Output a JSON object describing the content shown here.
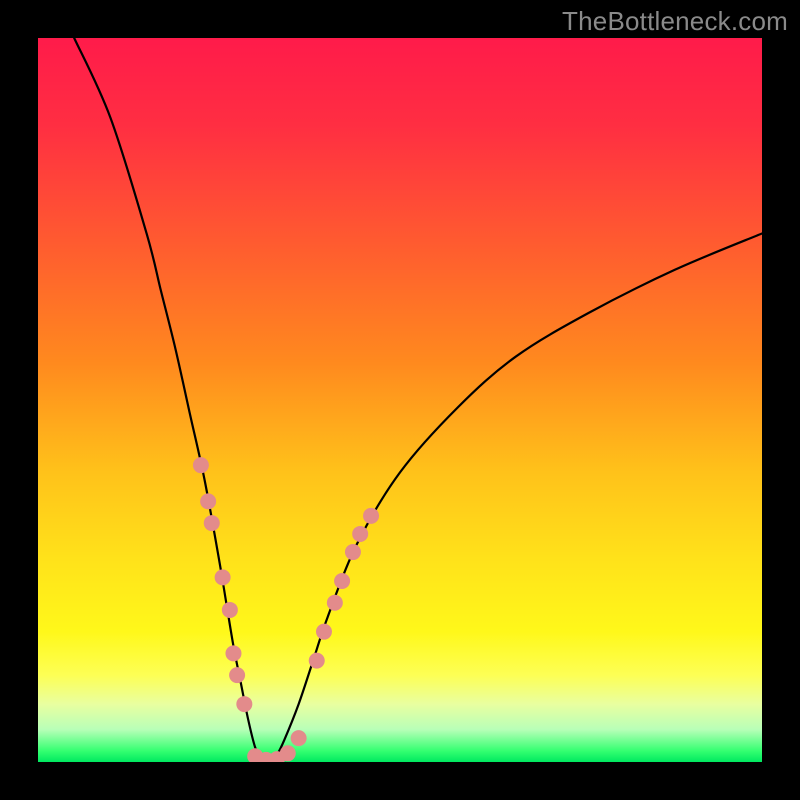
{
  "watermark": "TheBottleneck.com",
  "gradient_stops": [
    {
      "offset": 0.0,
      "color": "#ff1b4a"
    },
    {
      "offset": 0.12,
      "color": "#ff2e42"
    },
    {
      "offset": 0.28,
      "color": "#ff5a30"
    },
    {
      "offset": 0.45,
      "color": "#ff8a1e"
    },
    {
      "offset": 0.6,
      "color": "#ffc21a"
    },
    {
      "offset": 0.72,
      "color": "#ffe21a"
    },
    {
      "offset": 0.82,
      "color": "#fff81a"
    },
    {
      "offset": 0.88,
      "color": "#fdff55"
    },
    {
      "offset": 0.92,
      "color": "#e9ffa0"
    },
    {
      "offset": 0.955,
      "color": "#b8ffb8"
    },
    {
      "offset": 0.985,
      "color": "#33ff70"
    },
    {
      "offset": 1.0,
      "color": "#00e860"
    }
  ],
  "chart_data": {
    "type": "line",
    "title": "",
    "xlabel": "",
    "ylabel": "",
    "xlim": [
      0,
      100
    ],
    "ylim": [
      0,
      100
    ],
    "grid": false,
    "series": [
      {
        "name": "bottleneck-curve",
        "x": [
          5,
          10,
          15,
          17,
          19,
          21,
          23,
          25,
          26,
          27,
          28,
          29,
          30,
          31,
          32,
          33,
          34,
          36,
          38,
          40,
          44,
          50,
          58,
          66,
          76,
          88,
          100
        ],
        "y": [
          100,
          89,
          73,
          65,
          57,
          48,
          39,
          28,
          22,
          16,
          11,
          6,
          2,
          0,
          0,
          1,
          3,
          8,
          14,
          20,
          30,
          40,
          49,
          56,
          62,
          68,
          73
        ]
      }
    ],
    "markers": [
      {
        "name": "dots-left",
        "color": "#e38b8b",
        "radius": 8,
        "points": [
          {
            "x": 22.5,
            "y": 41
          },
          {
            "x": 23.5,
            "y": 36
          },
          {
            "x": 24.0,
            "y": 33
          },
          {
            "x": 25.5,
            "y": 25.5
          },
          {
            "x": 26.5,
            "y": 21
          },
          {
            "x": 27.0,
            "y": 15
          },
          {
            "x": 27.5,
            "y": 12
          },
          {
            "x": 28.5,
            "y": 8
          }
        ]
      },
      {
        "name": "dots-bottom",
        "color": "#e38b8b",
        "radius": 8,
        "points": [
          {
            "x": 30.0,
            "y": 0.8
          },
          {
            "x": 31.5,
            "y": 0.3
          },
          {
            "x": 33.0,
            "y": 0.4
          },
          {
            "x": 34.5,
            "y": 1.2
          },
          {
            "x": 36.0,
            "y": 3.3
          }
        ]
      },
      {
        "name": "dots-right",
        "color": "#e38b8b",
        "radius": 8,
        "points": [
          {
            "x": 38.5,
            "y": 14
          },
          {
            "x": 39.5,
            "y": 18
          },
          {
            "x": 41.0,
            "y": 22
          },
          {
            "x": 42.0,
            "y": 25
          },
          {
            "x": 43.5,
            "y": 29
          },
          {
            "x": 44.5,
            "y": 31.5
          },
          {
            "x": 46.0,
            "y": 34
          }
        ]
      }
    ]
  }
}
